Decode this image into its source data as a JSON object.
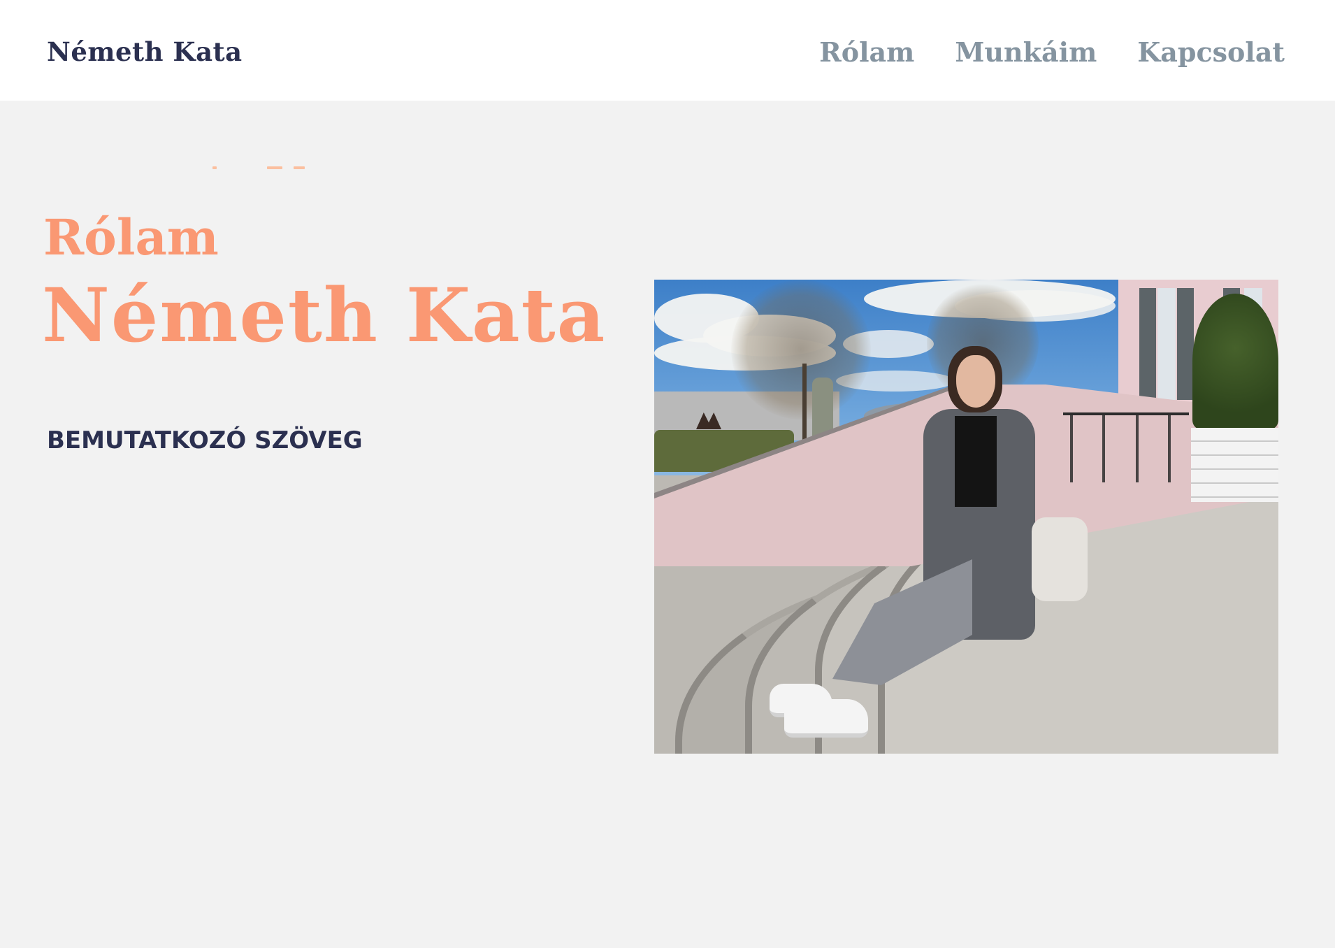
{
  "header": {
    "brand": "Németh Kata",
    "nav": [
      {
        "label": "Rólam"
      },
      {
        "label": "Munkáim"
      },
      {
        "label": "Kapcsolat"
      }
    ]
  },
  "hero": {
    "section_title": "Rólam",
    "name": "Németh Kata",
    "intro": "BEMUTATKOZÓ SZÖVEG"
  },
  "photo": {
    "subject": "portrait-photo"
  },
  "colors": {
    "accent": "#fa9873",
    "navy": "#2b3050",
    "nav_gray": "#8594a0",
    "background": "#f2f2f2",
    "header_bg": "#ffffff"
  }
}
